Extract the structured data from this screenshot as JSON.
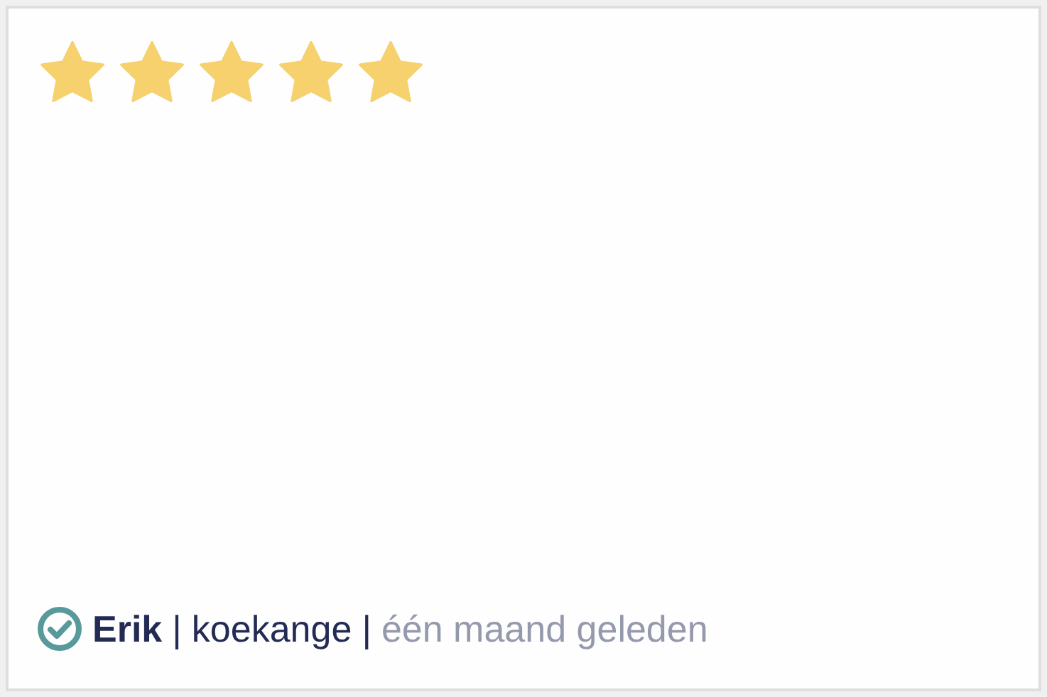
{
  "review": {
    "stars": 5,
    "verified": true,
    "author": "Erik",
    "separator_1": "|",
    "location": "koekange",
    "separator_2": "|",
    "time": "één maand geleden"
  }
}
